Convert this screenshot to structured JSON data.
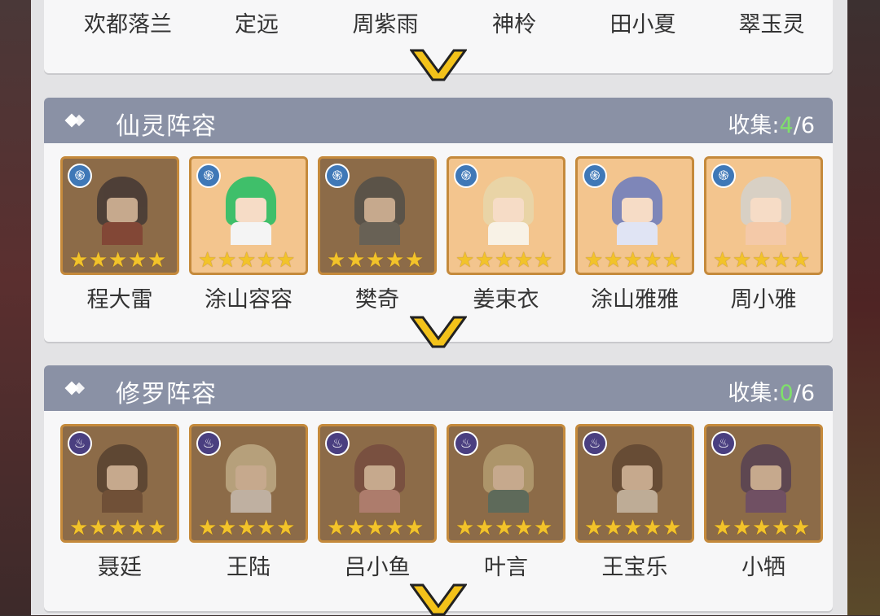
{
  "top_names": [
    "欢都落兰",
    "定远",
    "周紫雨",
    "神柃",
    "田小夏",
    "翠玉灵"
  ],
  "sections": [
    {
      "title": "仙灵阵容",
      "count_label": "收集:",
      "collected": "4",
      "total": "/6",
      "element_icon": "xianling-swirl-icon",
      "characters": [
        {
          "name": "程大雷",
          "collected": false,
          "stars": 5,
          "hair": "#1d1d2a",
          "body": "#7a2a28"
        },
        {
          "name": "涂山容容",
          "collected": true,
          "stars": 5,
          "hair": "#3fbf6a",
          "body": "#f4f4f4"
        },
        {
          "name": "樊奇",
          "collected": false,
          "stars": 5,
          "hair": "#33404a",
          "body": "#4b5a60"
        },
        {
          "name": "姜束衣",
          "collected": true,
          "stars": 5,
          "hair": "#e9d4a6",
          "body": "#f8f2e6"
        },
        {
          "name": "涂山雅雅",
          "collected": true,
          "stars": 5,
          "hair": "#7e86b8",
          "body": "#e0e4f4"
        },
        {
          "name": "周小雅",
          "collected": true,
          "stars": 5,
          "hair": "#d8d0c4",
          "body": "#f4c9a8"
        }
      ]
    },
    {
      "title": "修罗阵容",
      "count_label": "收集:",
      "collected": "0",
      "total": "/6",
      "element_icon": "xiuluo-flame-icon",
      "characters": [
        {
          "name": "聂廷",
          "collected": false,
          "stars": 5,
          "hair": "#3a2a22",
          "body": "#5a3a2a"
        },
        {
          "name": "王陆",
          "collected": false,
          "stars": 5,
          "hair": "#d9cda6",
          "body": "#eaeaea"
        },
        {
          "name": "吕小鱼",
          "collected": false,
          "stars": 5,
          "hair": "#6a3a3a",
          "body": "#c98a8a"
        },
        {
          "name": "叶言",
          "collected": false,
          "stars": 5,
          "hair": "#c8b886",
          "body": "#3a6a6a"
        },
        {
          "name": "王宝乐",
          "collected": false,
          "stars": 5,
          "hair": "#4a3426",
          "body": "#e8e2d6"
        },
        {
          "name": "小牺",
          "collected": false,
          "stars": 5,
          "hair": "#3a2a5a",
          "body": "#5a3a7a"
        }
      ]
    }
  ],
  "colors": {
    "accent_green": "#7fe06a",
    "chevron_yellow": "#f3c21a",
    "header_bg": "#8a91a5",
    "frame_gold": "#c58a3c"
  }
}
